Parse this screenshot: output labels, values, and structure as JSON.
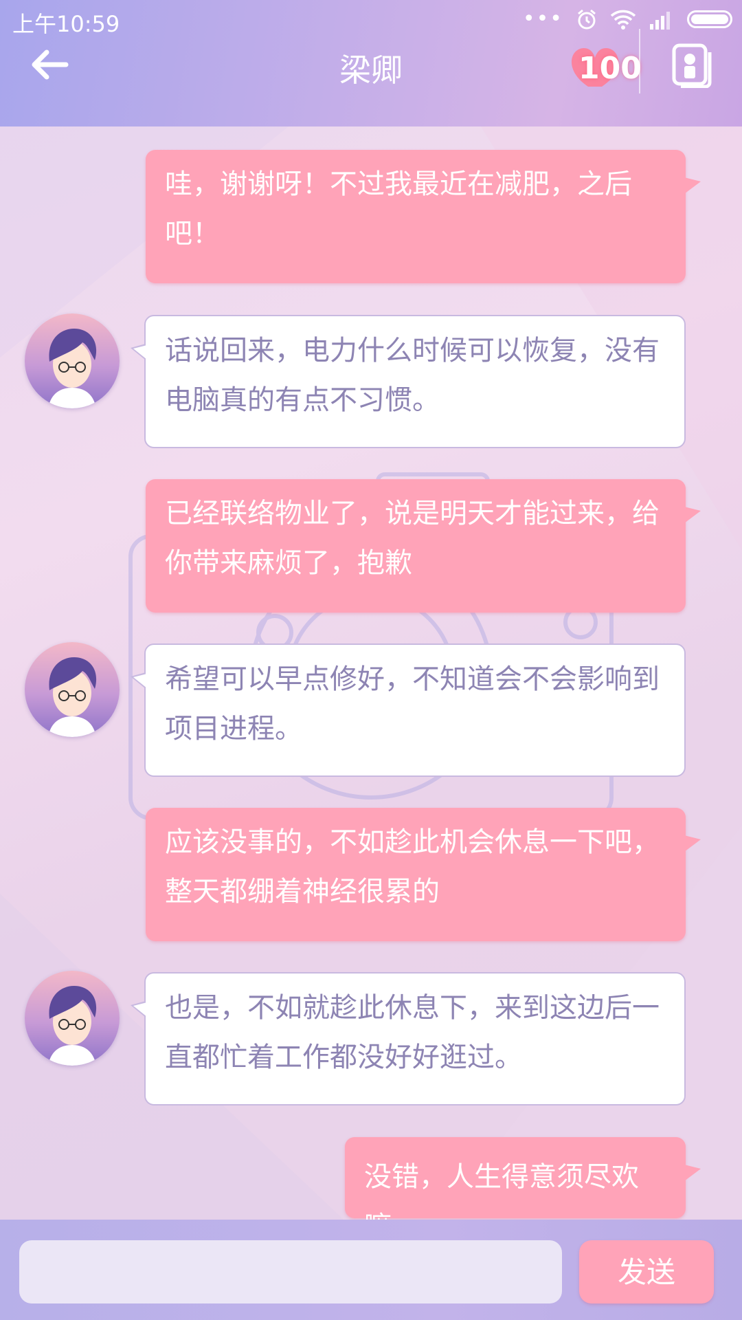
{
  "status_bar": {
    "time": "上午10:59"
  },
  "header": {
    "title": "梁卿",
    "affection_count": "100"
  },
  "messages": [
    {
      "sender": "me",
      "text": "哇，谢谢呀！不过我最近在减肥，之后吧！"
    },
    {
      "sender": "other",
      "text": "话说回来，电力什么时候可以恢复，没有电脑真的有点不习惯。"
    },
    {
      "sender": "me",
      "text": "已经联络物业了，说是明天才能过来，给你带来麻烦了，抱歉"
    },
    {
      "sender": "other",
      "text": "希望可以早点修好，不知道会不会影响到项目进程。"
    },
    {
      "sender": "me",
      "text": "应该没事的，不如趁此机会休息一下吧，整天都绷着神经很累的"
    },
    {
      "sender": "other",
      "text": "也是，不如就趁此休息下，来到这边后一直都忙着工作都没好好逛过。"
    },
    {
      "sender": "me",
      "text": "没错，人生得意须尽欢嘛"
    }
  ],
  "composer": {
    "input_value": "",
    "send_label": "发送"
  }
}
